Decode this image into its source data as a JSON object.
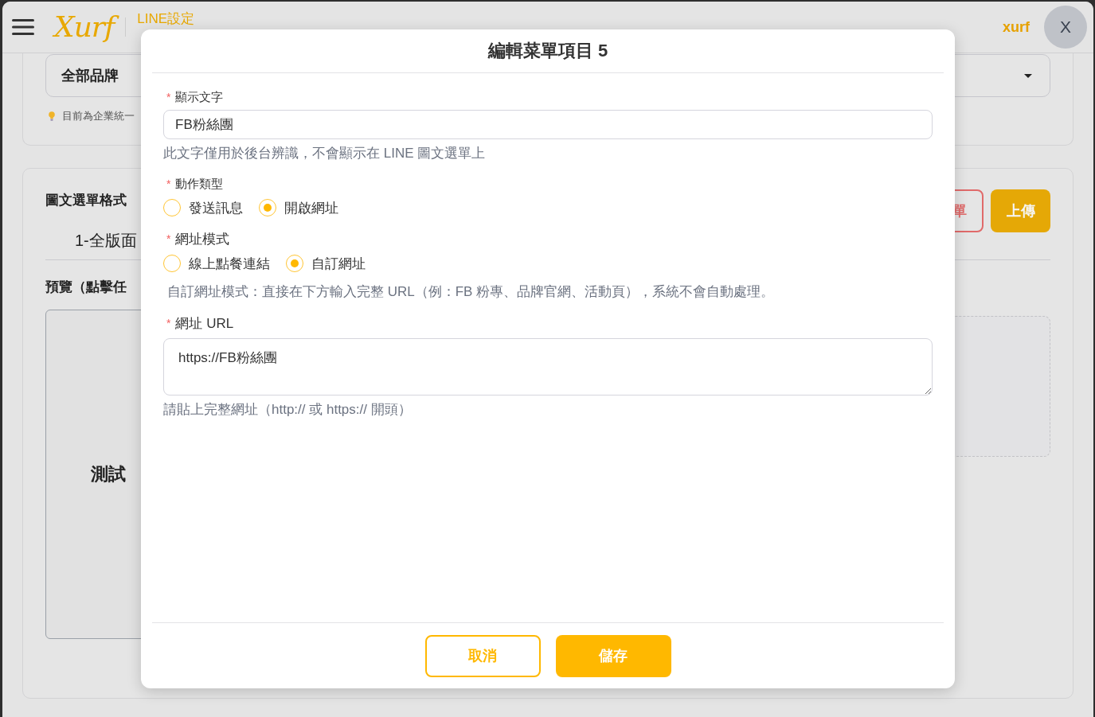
{
  "header": {
    "logo": "Xurf",
    "section_title": "LINE設定",
    "username": "xurf",
    "avatar_initial": "X"
  },
  "brand_card": {
    "brand_select": "全部品牌",
    "notice": "目前為企業統一"
  },
  "menu_card": {
    "format_title": "圖文選單格式",
    "buttons": [
      {
        "label": "單",
        "kind": "danger"
      },
      {
        "label": "上傳",
        "kind": "primary"
      }
    ],
    "layout_tabs": [
      {
        "label": "1-全版面",
        "selected": true
      }
    ],
    "preview_label": "預覽（點擊任",
    "preview_text": "測試"
  },
  "modal": {
    "title": "編輯菜單項目 5",
    "fields": [
      {
        "kind": "input",
        "required_mark": "*",
        "label": "顯示文字",
        "value": "FB粉絲團",
        "hint": "此文字僅用於後台辨識，不會顯示在 LINE 圖文選單上"
      },
      {
        "kind": "radio",
        "required_mark": "*",
        "label": "動作類型",
        "options": [
          {
            "label": "發送訊息",
            "selected": false
          },
          {
            "label": "開啟網址",
            "selected": true
          }
        ]
      },
      {
        "kind": "radio",
        "required_mark": "*",
        "label": "網址模式",
        "options": [
          {
            "label": "線上點餐連結",
            "selected": false
          },
          {
            "label": "自訂網址",
            "selected": true
          }
        ],
        "hint": "自訂網址模式：直接在下方輸入完整 URL（例：FB 粉專、品牌官網、活動頁），系統不會自動處理。"
      },
      {
        "kind": "textarea",
        "required_mark": "*",
        "label": "網址 URL",
        "value": "https://FB粉絲團",
        "hint": "請貼上完整網址（http:// 或 https:// 開頭）"
      }
    ],
    "buttons": [
      {
        "label": "取消",
        "kind": "secondary"
      },
      {
        "label": "儲存",
        "kind": "primary"
      }
    ]
  }
}
